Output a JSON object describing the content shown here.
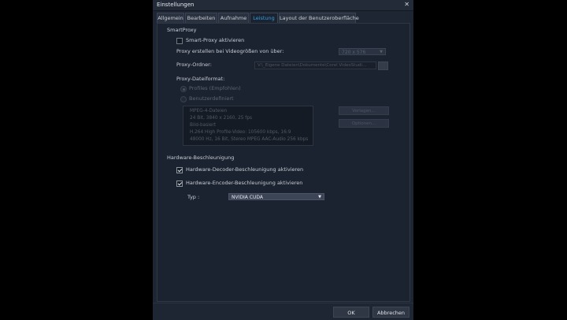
{
  "window": {
    "title": "Einstellungen",
    "close_glyph": "✕"
  },
  "tabs": [
    {
      "label": "Allgemein"
    },
    {
      "label": "Bearbeiten"
    },
    {
      "label": "Aufnahme"
    },
    {
      "label": "Leistung"
    },
    {
      "label": "Layout der Benutzeroberfläche"
    }
  ],
  "active_tab": "Leistung",
  "smartproxy": {
    "heading": "SmartProxy",
    "enable_label": "Smart-Proxy aktivieren",
    "enable_checked": false,
    "size_label": "Proxy erstellen bei Videogrößen von über:",
    "size_value": "720 x 576",
    "folder_label": "Proxy-Ordner:",
    "folder_value": "V:\\_Eigene Dateien\\Dokumente\\Corel VideoStudi...",
    "format_label": "Proxy-Dateiformat:",
    "radio_profiles": "Profiles (Empfohlen)",
    "radio_custom": "Benutzerdefiniert",
    "info_lines": [
      "MPEG-4-Dateien",
      "24 Bit, 3840 x 2160, 25 fps",
      "Bild-basiert",
      "H.264 High Profile-Video: 105600 kbps, 16:9",
      "48000 Hz, 16 Bit, Stereo MPEG AAC-Audio 256 kbps"
    ],
    "btn_template": "Vorlagen...",
    "btn_options": "Optionen..."
  },
  "hardware": {
    "heading": "Hardware-Beschleunigung",
    "decoder_label": "Hardware-Decoder-Beschleunigung aktivieren",
    "decoder_checked": true,
    "encoder_label": "Hardware-Encoder-Beschleunigung aktivieren",
    "encoder_checked": true,
    "type_label": "Typ :",
    "type_value": "NVIDIA CUDA"
  },
  "footer": {
    "ok": "OK",
    "cancel": "Abbrechen"
  },
  "colors": {
    "accent": "#33a1e0",
    "background": "#1f2633",
    "panel": "#1b2230"
  }
}
